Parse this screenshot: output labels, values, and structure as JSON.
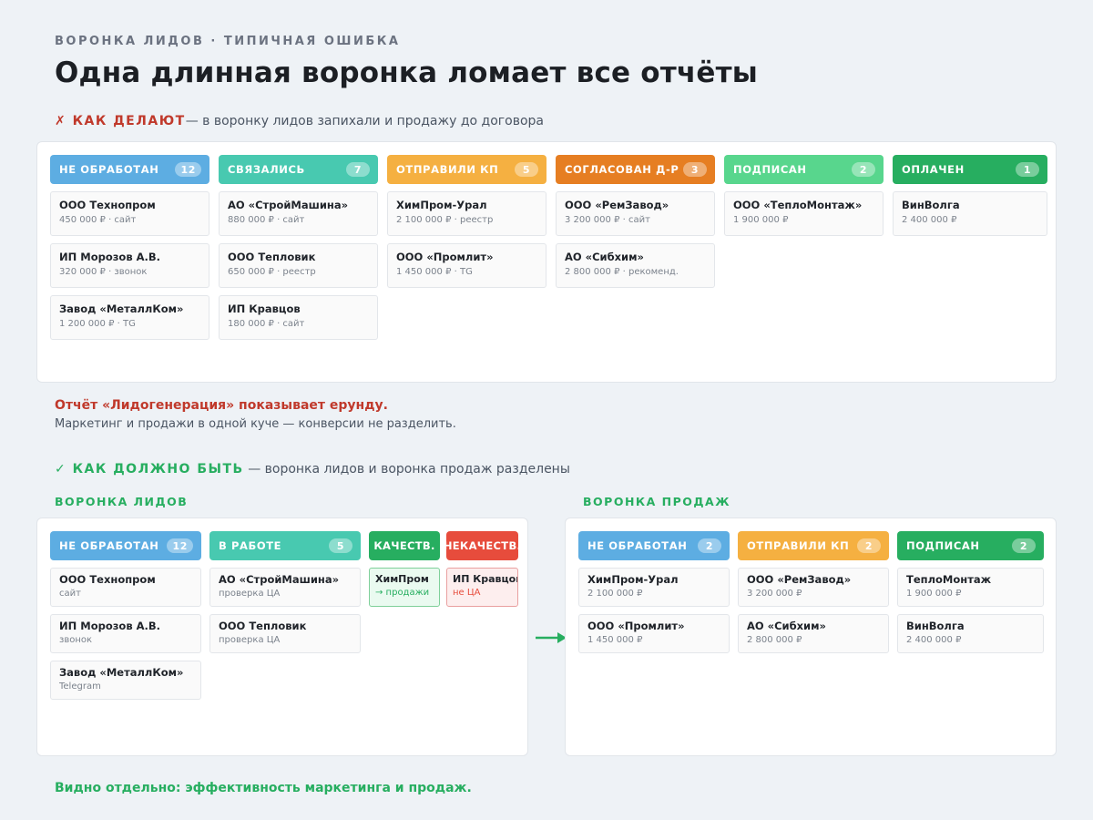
{
  "header": {
    "kicker": "ВОРОНКА ЛИДОВ · ТИПИЧНАЯ ОШИБКА",
    "title": "Одна длинная воронка ломает все отчёты"
  },
  "wrong": {
    "mark": "✗ КАК ДЕЛАЮТ",
    "desc": "— в воронку лидов запихали и продажу до договора",
    "columns": [
      {
        "label": "НЕ ОБРАБОТАН",
        "count": "12",
        "color": "#5dade2",
        "cards": [
          {
            "name": "ООО Технопром",
            "meta": "450 000 ₽ · сайт"
          },
          {
            "name": "ИП Морозов А.В.",
            "meta": "320 000 ₽ · звонок"
          },
          {
            "name": "Завод «МеталлКом»",
            "meta": "1 200 000 ₽ · TG"
          }
        ]
      },
      {
        "label": "СВЯЗАЛИСЬ",
        "count": "7",
        "color": "#48c9b0",
        "cards": [
          {
            "name": "АО «СтройМашина»",
            "meta": "880 000 ₽ · сайт"
          },
          {
            "name": "ООО Тепловик",
            "meta": "650 000 ₽ · реестр"
          },
          {
            "name": "ИП Кравцов",
            "meta": "180 000 ₽ · сайт"
          }
        ]
      },
      {
        "label": "ОТПРАВИЛИ КП",
        "count": "5",
        "color": "#f5b041",
        "cards": [
          {
            "name": "ХимПром-Урал",
            "meta": "2 100 000 ₽ · реестр"
          },
          {
            "name": "ООО «Промлит»",
            "meta": "1 450 000 ₽ · TG"
          }
        ]
      },
      {
        "label": "СОГЛАСОВАН Д-Р",
        "count": "3",
        "color": "#e67e22",
        "cards": [
          {
            "name": "ООО «РемЗавод»",
            "meta": "3 200 000 ₽ · сайт"
          },
          {
            "name": "АО «Сибхим»",
            "meta": "2 800 000 ₽ · рекоменд."
          }
        ]
      },
      {
        "label": "ПОДПИСАН",
        "count": "2",
        "color": "#58d68d",
        "cards": [
          {
            "name": "ООО «ТеплоМонтаж»",
            "meta": "1 900 000 ₽"
          }
        ]
      },
      {
        "label": "ОПЛАЧЕН",
        "count": "1",
        "color": "#27ae60",
        "cards": [
          {
            "name": "ВинВолга",
            "meta": "2 400 000 ₽"
          }
        ]
      }
    ],
    "consequence_title": "Отчёт «Лидогенерация» показывает ерунду.",
    "consequence_text": "Маркетинг и продажи в одной куче — конверсии не разделить."
  },
  "right": {
    "mark": "✓ КАК ДОЛЖНО БЫТЬ",
    "desc": "— воронка лидов и воронка продаж разделены",
    "leads_title": "ВОРОНКА ЛИДОВ",
    "sales_title": "ВОРОНКА ПРОДАЖ",
    "leads": [
      {
        "label": "НЕ ОБРАБОТАН",
        "count": "12",
        "cards": [
          {
            "name": "ООО Технопром",
            "meta": "сайт"
          },
          {
            "name": "ИП Морозов А.В.",
            "meta": "звонок"
          },
          {
            "name": "Завод «МеталлКом»",
            "meta": "Telegram"
          }
        ]
      },
      {
        "label": "В РАБОТЕ",
        "count": "5",
        "cards": [
          {
            "name": "АО «СтройМашина»",
            "meta": "проверка ЦА"
          },
          {
            "name": "ООО Тепловик",
            "meta": "проверка ЦА"
          }
        ]
      },
      {
        "label": "КАЧЕСТВ.",
        "cards": [
          {
            "name": "ХимПром",
            "meta": "→ продажи"
          }
        ]
      },
      {
        "label": "НЕКАЧЕСТВ.",
        "cards": [
          {
            "name": "ИП Кравцов",
            "meta": "не ЦА"
          }
        ]
      }
    ],
    "sales": [
      {
        "label": "НЕ ОБРАБОТАН",
        "count": "2",
        "cards": [
          {
            "name": "ХимПром-Урал",
            "meta": "2 100 000 ₽"
          },
          {
            "name": "ООО «Промлит»",
            "meta": "1 450 000 ₽"
          }
        ]
      },
      {
        "label": "ОТПРАВИЛИ КП",
        "count": "2",
        "cards": [
          {
            "name": "ООО «РемЗавод»",
            "meta": "3 200 000 ₽"
          },
          {
            "name": "АО «Сибхим»",
            "meta": "2 800 000 ₽"
          }
        ]
      },
      {
        "label": "ПОДПИСАН",
        "count": "2",
        "cards": [
          {
            "name": "ТеплоМонтаж",
            "meta": "1 900 000 ₽"
          },
          {
            "name": "ВинВолга",
            "meta": "2 400 000 ₽"
          }
        ]
      }
    ],
    "conclusion": "Видно отдельно: эффективность маркетинга и продаж."
  }
}
